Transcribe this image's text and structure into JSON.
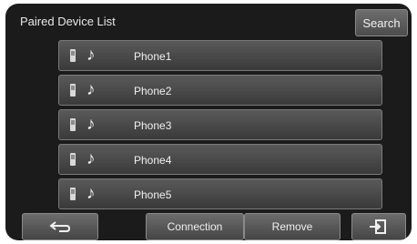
{
  "header": {
    "title": "Paired Device List",
    "search_label": "Search"
  },
  "devices": [
    {
      "name": "Phone1"
    },
    {
      "name": "Phone2"
    },
    {
      "name": "Phone3"
    },
    {
      "name": "Phone4"
    },
    {
      "name": "Phone5"
    }
  ],
  "icons": {
    "device": "phone-icon",
    "audio": "music-note-icon",
    "back": "back-arrow-icon",
    "exit": "exit-icon"
  },
  "footer": {
    "connection_label": "Connection",
    "remove_label": "Remove"
  }
}
